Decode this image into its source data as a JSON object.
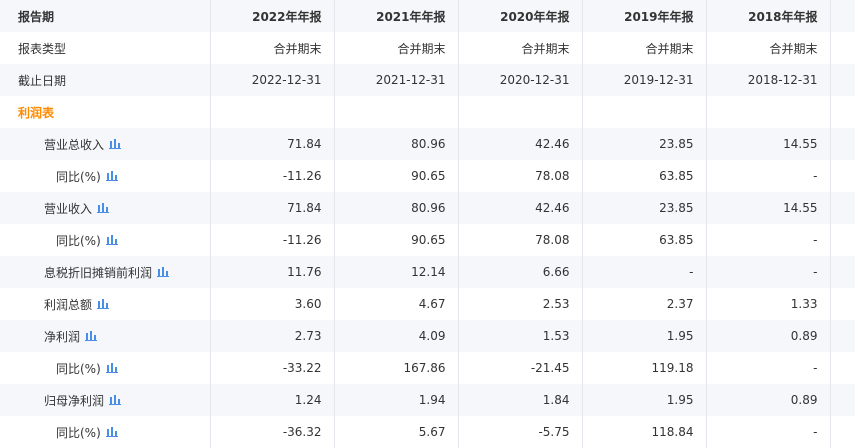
{
  "header": {
    "label": "报告期",
    "years": [
      "2022年年报",
      "2021年年报",
      "2020年年报",
      "2019年年报",
      "2018年年报"
    ]
  },
  "meta_rows": [
    {
      "label": "报表类型",
      "values": [
        "合并期末",
        "合并期末",
        "合并期末",
        "合并期末",
        "合并期末"
      ]
    },
    {
      "label": "截止日期",
      "values": [
        "2022-12-31",
        "2021-12-31",
        "2020-12-31",
        "2019-12-31",
        "2018-12-31"
      ]
    }
  ],
  "section": {
    "label": "利润表"
  },
  "rows": [
    {
      "label": "营业总收入",
      "values": [
        "71.84",
        "80.96",
        "42.46",
        "23.85",
        "14.55"
      ]
    },
    {
      "label": "同比(%)",
      "values": [
        "-11.26",
        "90.65",
        "78.08",
        "63.85",
        "-"
      ]
    },
    {
      "label": "营业收入",
      "values": [
        "71.84",
        "80.96",
        "42.46",
        "23.85",
        "14.55"
      ]
    },
    {
      "label": "同比(%)",
      "values": [
        "-11.26",
        "90.65",
        "78.08",
        "63.85",
        "-"
      ]
    },
    {
      "label": "息税折旧摊销前利润",
      "values": [
        "11.76",
        "12.14",
        "6.66",
        "-",
        "-"
      ]
    },
    {
      "label": "利润总额",
      "values": [
        "3.60",
        "4.67",
        "2.53",
        "2.37",
        "1.33"
      ]
    },
    {
      "label": "净利润",
      "values": [
        "2.73",
        "4.09",
        "1.53",
        "1.95",
        "0.89"
      ]
    },
    {
      "label": "同比(%)",
      "values": [
        "-33.22",
        "167.86",
        "-21.45",
        "119.18",
        "-"
      ]
    },
    {
      "label": "归母净利润",
      "values": [
        "1.24",
        "1.94",
        "1.84",
        "1.95",
        "0.89"
      ]
    },
    {
      "label": "同比(%)",
      "values": [
        "-36.32",
        "5.67",
        "-5.75",
        "118.84",
        "-"
      ]
    }
  ],
  "colors": {
    "section": "#ff8a00",
    "icon": "#4a8fe7",
    "stripe": "#f5f7fa"
  },
  "icon_name": "bar-chart-icon"
}
